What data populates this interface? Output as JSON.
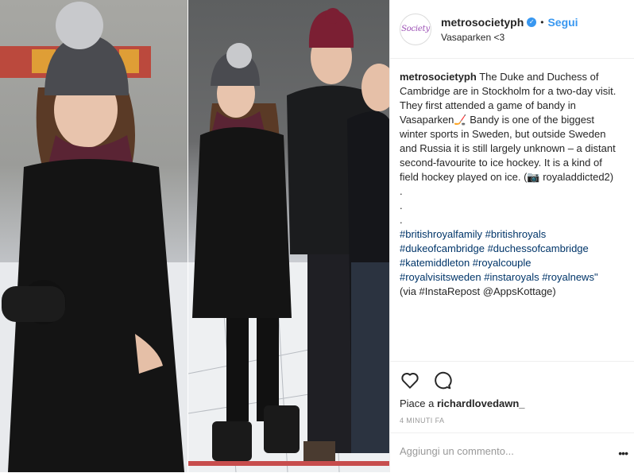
{
  "post": {
    "username": "metrosocietyph",
    "verified_icon": "verified-badge-icon",
    "separator": "•",
    "follow_label": "Segui",
    "location": "Vasaparken <3",
    "avatar_text": "Society",
    "caption": {
      "author": "metrosocietyph",
      "text": "The Duke and Duchess of Cambridge are in Stockholm for a two-day visit. They first attended a game of bandy in Vasaparken🏒 Bandy is one of the biggest winter sports in Sweden, but outside Sweden and Russia it is still largely unknown – a distant second-favourite to ice hockey. It is a kind of field hockey played on ice. (📷 royaladdicted2)",
      "dots": [
        ".",
        ".",
        "."
      ],
      "hashtag_lines": [
        "#britishroyalfamily #britishroyals",
        "#dukeofcambridge #duchessofcambridge",
        "#katemiddleton #royalcouple",
        "#royalvisitsweden #instaroyals #royalnews\""
      ],
      "via_line": "(via #InstaRepost @AppsKottage)"
    },
    "likes_prefix": "Piace a ",
    "likes_user": "richardlovedawn_",
    "timestamp": "4 MINUTI FA",
    "comment_placeholder": "Aggiungi un commento...",
    "more_label": "•••",
    "icons": [
      "heart-icon",
      "comment-icon"
    ],
    "colors": {
      "link": "#3897f0",
      "hashtag": "#003569",
      "muted": "#999999"
    }
  }
}
